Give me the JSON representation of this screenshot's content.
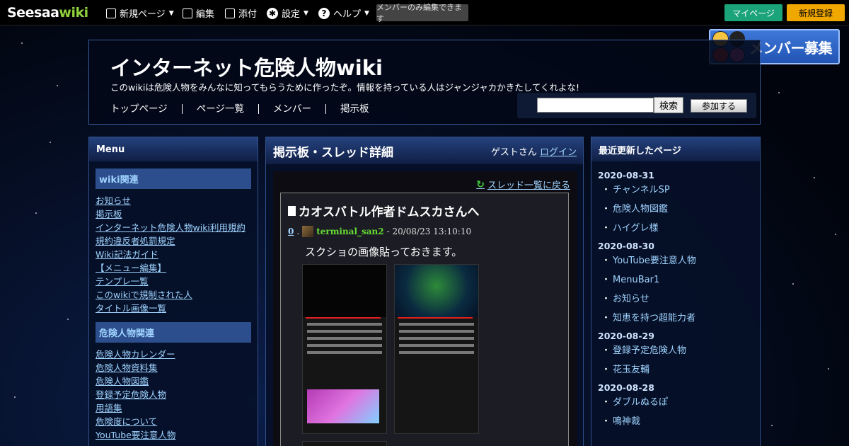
{
  "topbar": {
    "logo_main": "Seesaa",
    "logo_accent": "wiki",
    "items": [
      {
        "label": "新規ページ",
        "icon": "list-icon"
      },
      {
        "label": "編集",
        "icon": "edit-icon"
      },
      {
        "label": "添付",
        "icon": "image-icon"
      },
      {
        "label": "設定",
        "icon": "gear-icon"
      },
      {
        "label": "ヘルプ",
        "icon": "help-icon"
      }
    ],
    "members_only": "メンバーのみ編集できます",
    "mypage": "マイページ",
    "signup": "新規登録"
  },
  "banner": {
    "label": "メンバー募集"
  },
  "header": {
    "title": "インターネット危険人物wiki",
    "description": "このwikiは危険人物をみんなに知ってもらうために作ったぞ。情報を持っている人はジャンジャカかきたしてくれよな!",
    "nav": [
      "トップページ",
      "ページ一覧",
      "メンバー",
      "掲示板"
    ],
    "search_button": "検索",
    "join_button": "参加する"
  },
  "menu": {
    "title": "Menu",
    "sections": [
      {
        "heading": "wiki関連",
        "items": [
          "お知らせ",
          "掲示板",
          "インターネット危険人物wiki利用規約",
          "規約違反者処罰規定",
          "Wiki記法ガイド",
          "【メニュー編集】",
          "テンプレ一覧",
          "このwikiで規制された人",
          "タイトル画像一覧"
        ]
      },
      {
        "heading": "危険人物関連",
        "items": [
          "危険人物カレンダー",
          "危険人物資料集",
          "危険人物図鑑",
          "登録予定危険人物",
          "用語集",
          "危険度について",
          "YouTube要注意人物"
        ]
      }
    ]
  },
  "thread": {
    "page_title": "掲示板・スレッド詳細",
    "guest": "ゲストさん",
    "login": "ログイン",
    "back_link": "スレッド一覧に戻る",
    "title": "カオスバトル作者ドムスカさんへ",
    "post": {
      "number": "0",
      "author": "terminal_san2",
      "timestamp": "- 20/08/23 13:10:10",
      "body": "スクショの画像貼っておきます。"
    }
  },
  "recent": {
    "title": "最近更新したページ",
    "groups": [
      {
        "date": "2020-08-31",
        "items": [
          "チャンネルSP",
          "危険人物図鑑",
          "ハイグレ様"
        ]
      },
      {
        "date": "2020-08-30",
        "items": [
          "YouTube要注意人物",
          "MenuBar1",
          "お知らせ",
          "知恵を持つ超能力者"
        ]
      },
      {
        "date": "2020-08-29",
        "items": [
          "登録予定危険人物",
          "花玉友輔"
        ]
      },
      {
        "date": "2020-08-28",
        "items": [
          "ダブルぬるぽ",
          "鳴神裁"
        ]
      }
    ]
  },
  "colors": {
    "link": "#9fd3ff",
    "accent_green": "#1ba37a",
    "accent_orange": "#f0a800",
    "author": "#66dd33"
  }
}
